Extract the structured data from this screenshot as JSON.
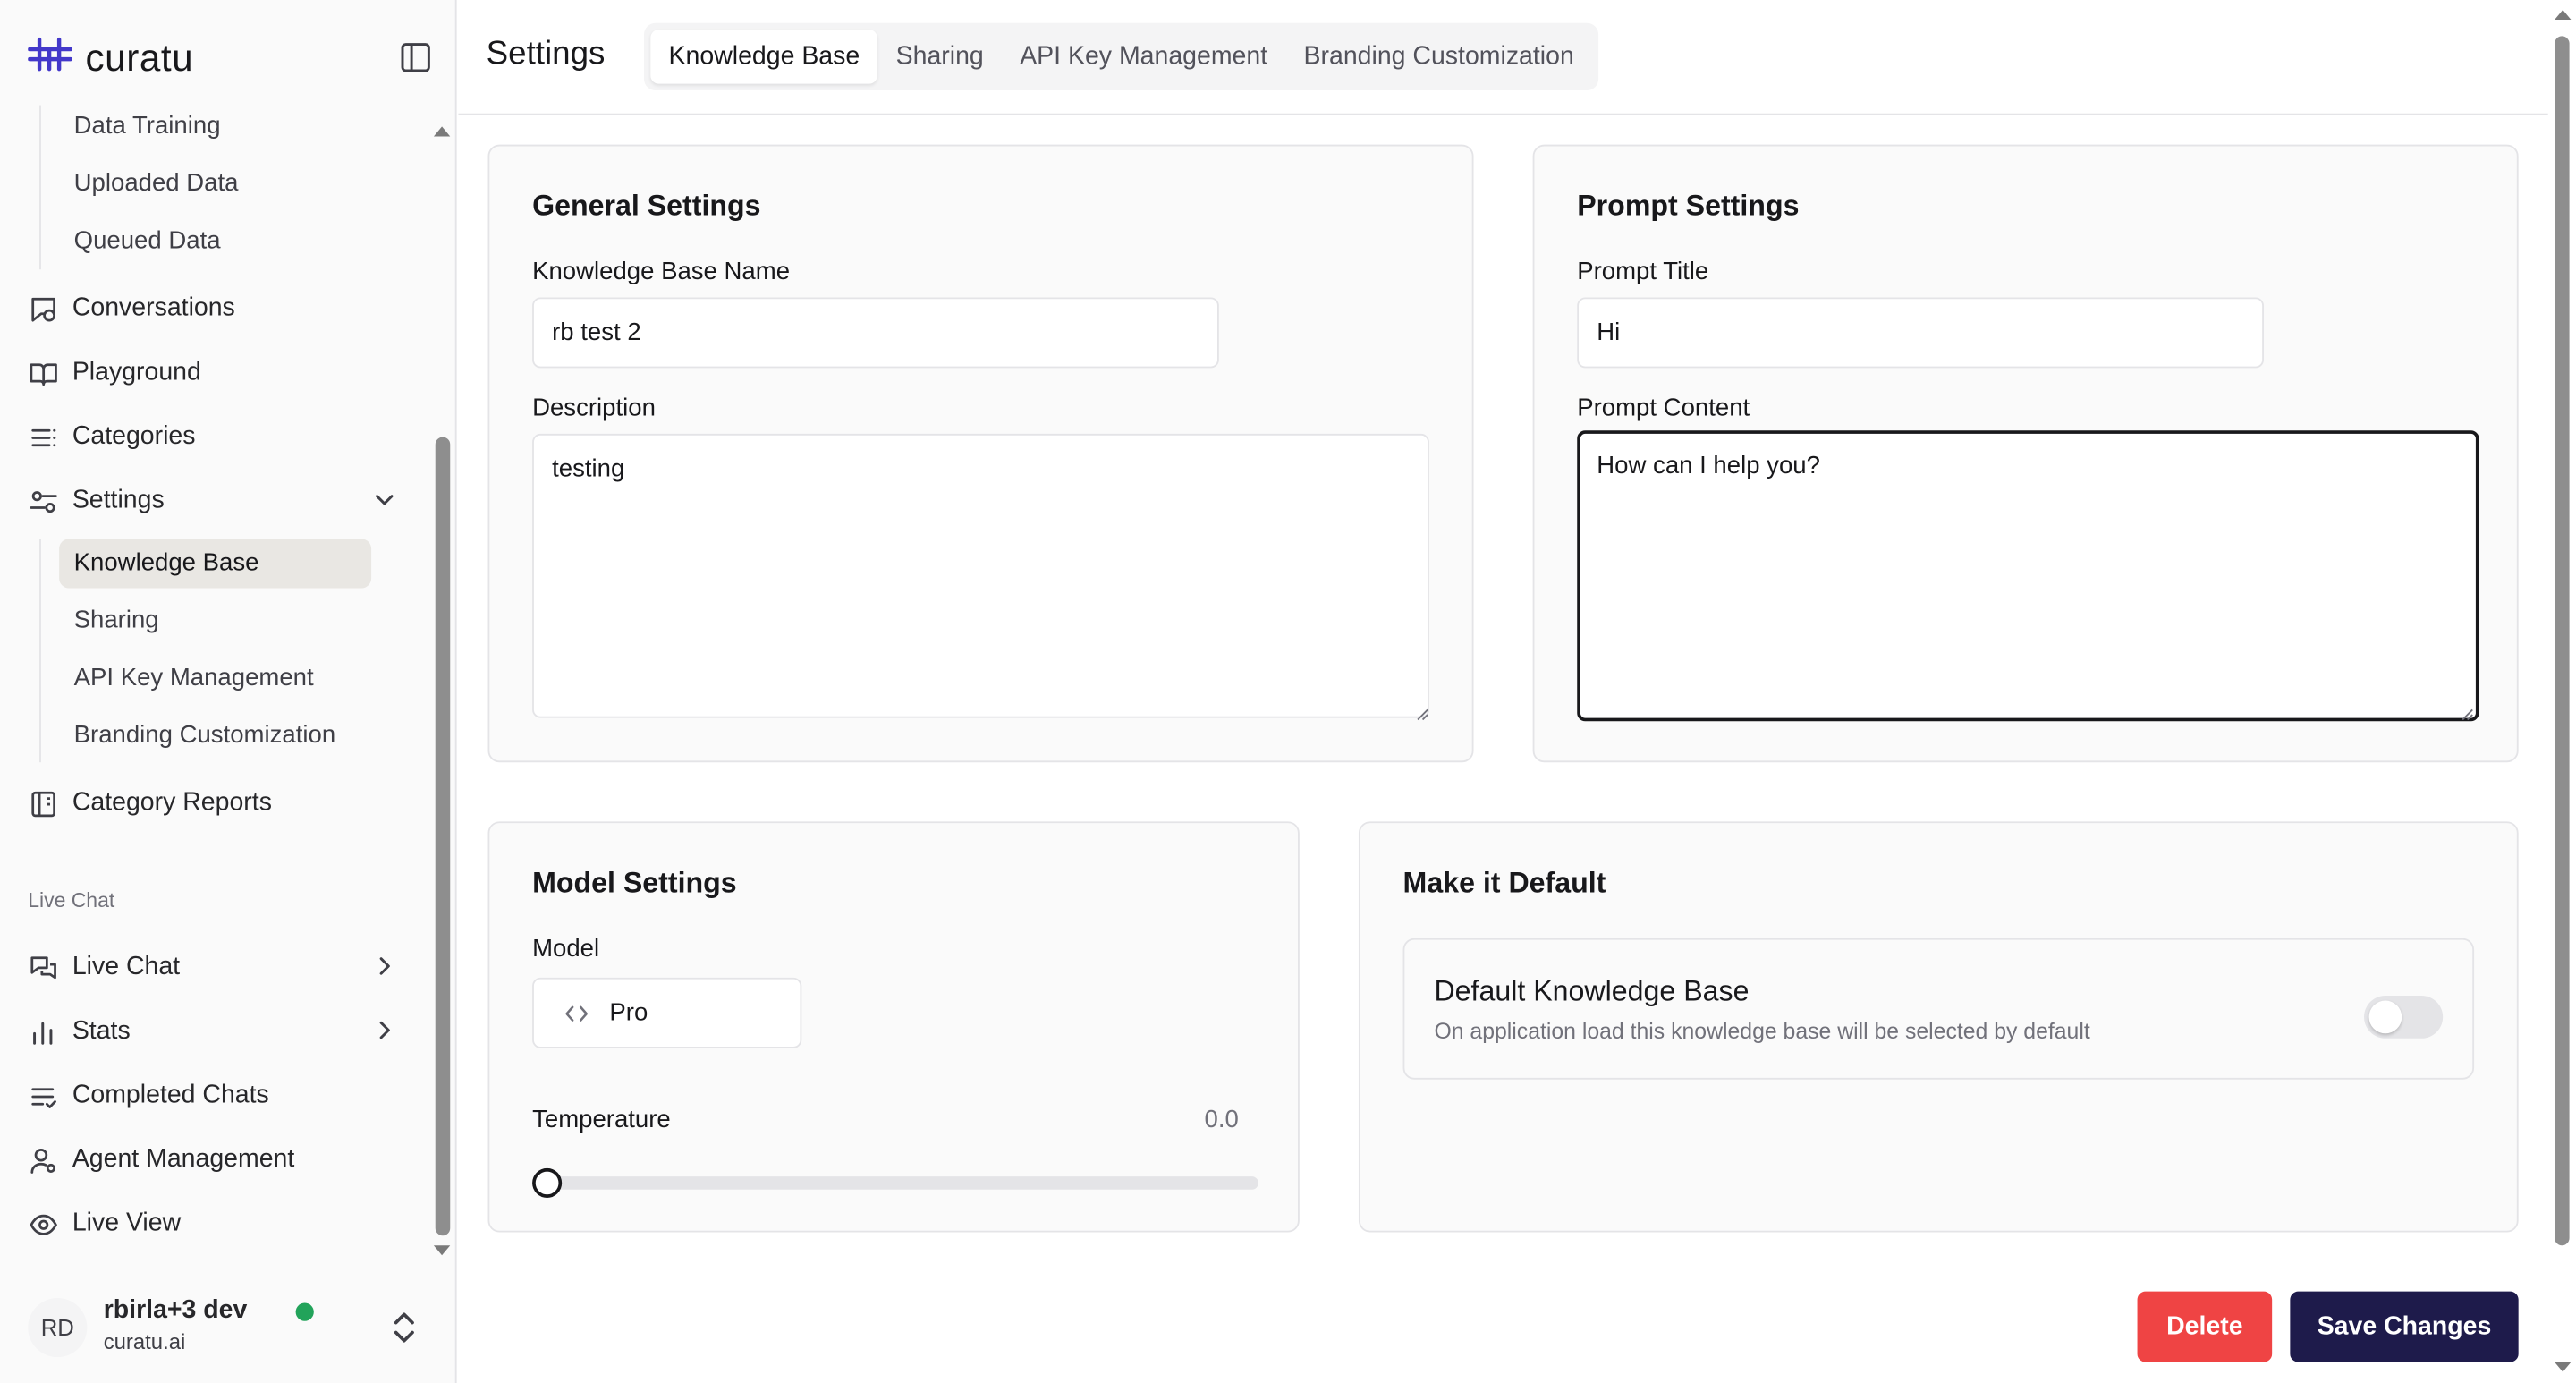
{
  "brand": {
    "name": "curatu",
    "logo_icon": "curatu-logo-icon",
    "accent": "#4338ca"
  },
  "sidebar": {
    "toggle_icon": "sidebar-toggle-icon",
    "data_sub": [
      "Data Training",
      "Uploaded Data",
      "Queued Data"
    ],
    "items": {
      "conversations": "Conversations",
      "playground": "Playground",
      "categories": "Categories",
      "settings": "Settings",
      "category_reports": "Category Reports"
    },
    "settings_sub": [
      "Knowledge Base",
      "Sharing",
      "API Key Management",
      "Branding Customization"
    ],
    "live_chat_section": "Live Chat",
    "live_items": {
      "live_chat": "Live Chat",
      "stats": "Stats",
      "completed_chats": "Completed Chats",
      "agent_management": "Agent Management",
      "live_view": "Live View"
    }
  },
  "user": {
    "initials": "RD",
    "name": "rbirla+3 dev",
    "org": "curatu.ai",
    "status_color": "#22a35a"
  },
  "header": {
    "title": "Settings",
    "tabs": [
      "Knowledge Base",
      "Sharing",
      "API Key Management",
      "Branding Customization"
    ],
    "active_tab": "Knowledge Base"
  },
  "general": {
    "title": "General Settings",
    "kb_name_label": "Knowledge Base Name",
    "kb_name_value": "rb test 2",
    "description_label": "Description",
    "description_value": "testing"
  },
  "prompt": {
    "title": "Prompt Settings",
    "title_label": "Prompt Title",
    "title_value": "Hi",
    "content_label": "Prompt Content",
    "content_value": "How can I help you?"
  },
  "model": {
    "title": "Model Settings",
    "model_label": "Model",
    "model_value": "Pro",
    "temperature_label": "Temperature",
    "temperature_value": "0.0",
    "temperature_fraction": 0
  },
  "default": {
    "title": "Make it Default",
    "box_title": "Default Knowledge Base",
    "box_desc": "On application load this knowledge base will be selected by default",
    "enabled": false
  },
  "actions": {
    "delete": "Delete",
    "save": "Save Changes",
    "delete_color": "#ef4444",
    "save_color": "#1e1b4b"
  }
}
